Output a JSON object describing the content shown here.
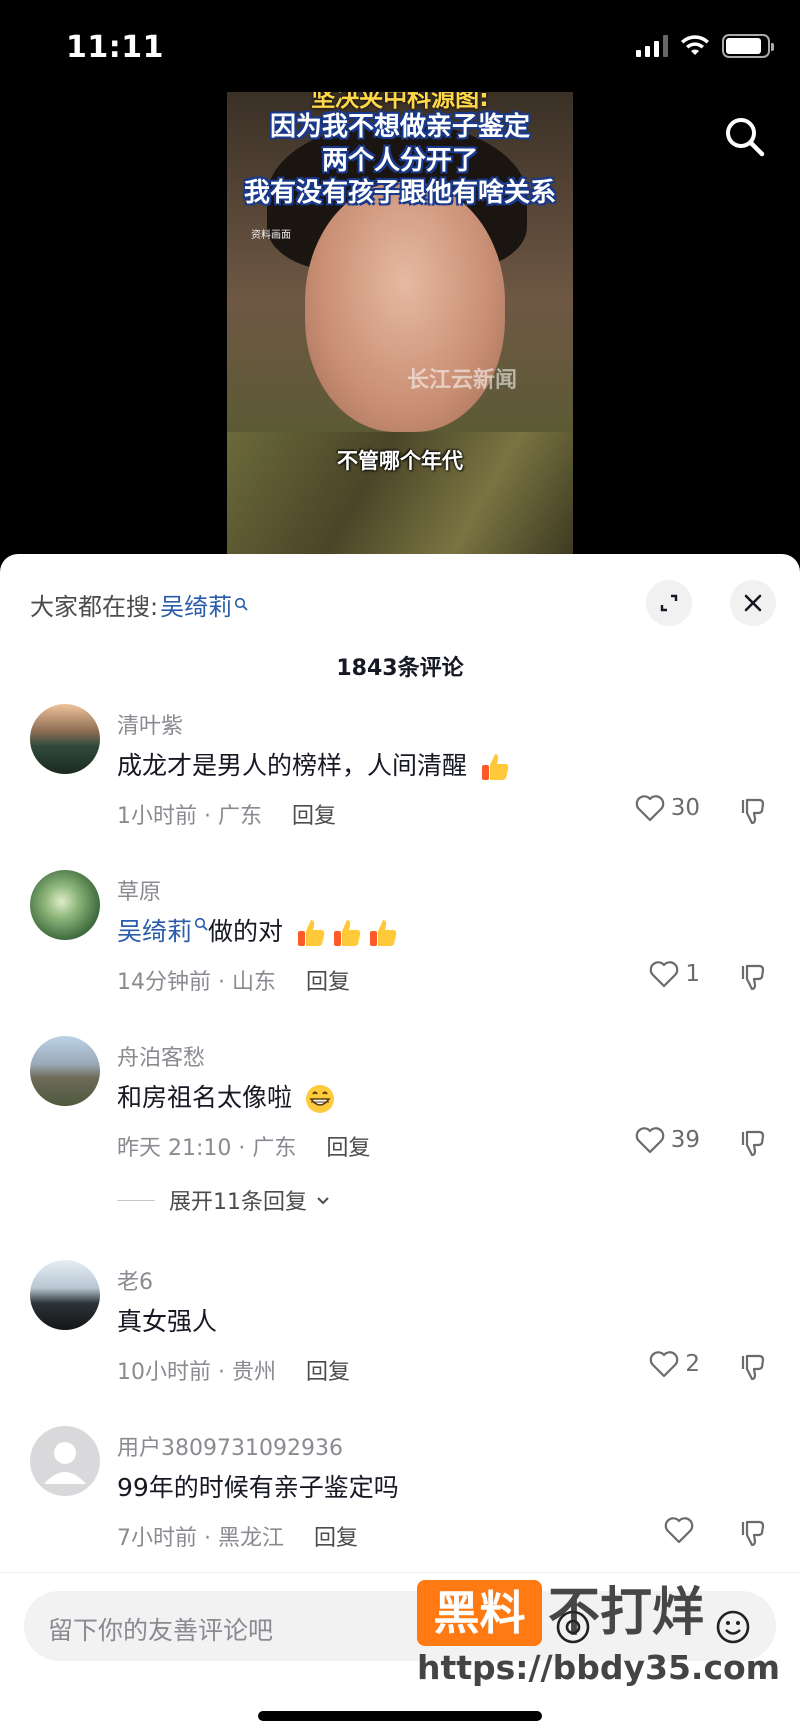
{
  "status_bar": {
    "time": "11:11"
  },
  "video": {
    "caption_top": "坚决夹中科源图:",
    "caption_line1": "因为我不想做亲子鉴定",
    "caption_line2": "两个人分开了",
    "caption_line3": "我有没有孩子跟他有啥关系",
    "small_label": "资料画面",
    "watermark": "长江云新闻",
    "subtitle": "不管哪个年代"
  },
  "panel": {
    "search_prefix": "大家都在搜:",
    "search_keyword": "吴绮莉",
    "comment_count": "1843条评论",
    "expand_replies_label": "展开11条回复"
  },
  "comments": [
    {
      "author": "清叶紫",
      "text": "成龙才是男人的榜样，人间清醒",
      "meta": "1小时前 · 广东",
      "reply": "回复",
      "likes": "30"
    },
    {
      "author": "草原",
      "keyword": "吴绮莉",
      "text": "做的对",
      "meta": "14分钟前 · 山东",
      "reply": "回复",
      "likes": "1"
    },
    {
      "author": "舟泊客愁",
      "text": "和房祖名太像啦",
      "meta": "昨天 21:10 · 广东",
      "reply": "回复",
      "likes": "39"
    },
    {
      "author": "老6",
      "text": "真女强人",
      "meta": "10小时前 · 贵州",
      "reply": "回复",
      "likes": "2"
    },
    {
      "author": "用户3809731092936",
      "text": "99年的时候有亲子鉴定吗",
      "meta": "7小时前 · 黑龙江",
      "reply": "回复",
      "likes": ""
    }
  ],
  "bottom_bar": {
    "placeholder": "留下你的友善评论吧"
  },
  "watermark": {
    "box": "黑料",
    "text": "不打烊",
    "url": "https://bbdy35.com"
  },
  "colors": {
    "keyword_blue": "#2a5ca8",
    "watermark_orange": "#ff7a12"
  },
  "icons": [
    "search-icon",
    "expand-icon",
    "close-icon",
    "heart-icon",
    "dislike-icon",
    "thumbs-up-emoji",
    "grin-emoji",
    "at-icon",
    "emoji-icon"
  ]
}
